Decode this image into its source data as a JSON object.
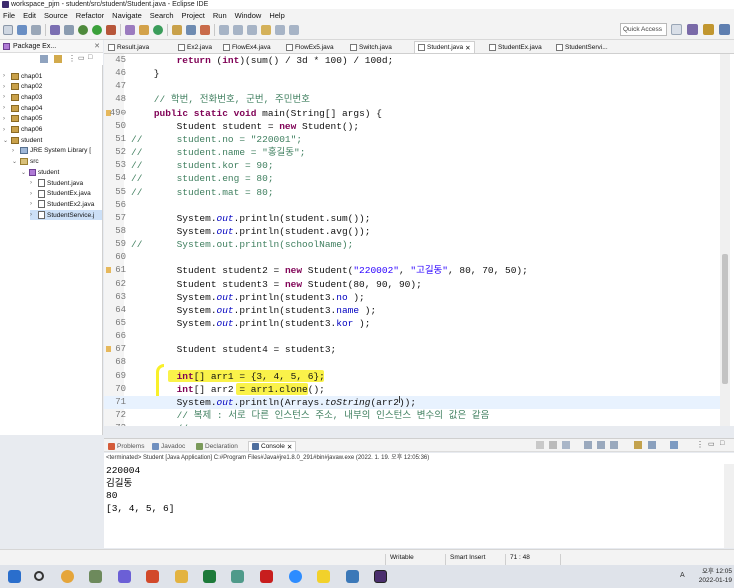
{
  "window": {
    "title": "workspace_pjm - student/src/student/Student.java - Eclipse IDE"
  },
  "menu": [
    "File",
    "Edit",
    "Source",
    "Refactor",
    "Navigate",
    "Search",
    "Project",
    "Run",
    "Window",
    "Help"
  ],
  "quick_access": {
    "placeholder": "Quick Access"
  },
  "package_explorer": {
    "title": "Package Ex...",
    "items": [
      {
        "label": "chap01",
        "level": 0,
        "type": "project",
        "expanded": false
      },
      {
        "label": "chap02",
        "level": 0,
        "type": "project",
        "expanded": false
      },
      {
        "label": "chap03",
        "level": 0,
        "type": "project",
        "expanded": false
      },
      {
        "label": "chap04",
        "level": 0,
        "type": "project",
        "expanded": false
      },
      {
        "label": "chap05",
        "level": 0,
        "type": "project",
        "expanded": false
      },
      {
        "label": "chap06",
        "level": 0,
        "type": "project",
        "expanded": false
      },
      {
        "label": "student",
        "level": 0,
        "type": "project",
        "expanded": true
      },
      {
        "label": "JRE System Library [",
        "level": 1,
        "type": "library",
        "expanded": false
      },
      {
        "label": "src",
        "level": 1,
        "type": "src",
        "expanded": true
      },
      {
        "label": "student",
        "level": 2,
        "type": "package",
        "expanded": true
      },
      {
        "label": "Student.java",
        "level": 3,
        "type": "java",
        "expanded": false
      },
      {
        "label": "StudentEx.java",
        "level": 3,
        "type": "java",
        "expanded": false
      },
      {
        "label": "StudentEx2.java",
        "level": 3,
        "type": "java",
        "expanded": false
      },
      {
        "label": "StudentService.j",
        "level": 3,
        "type": "java",
        "expanded": false,
        "selected": true
      }
    ]
  },
  "editor_tabs": [
    {
      "label": "Result.java",
      "active": false
    },
    {
      "label": "Ex2.java",
      "active": false
    },
    {
      "label": "FlowEx4.java",
      "active": false
    },
    {
      "label": "FlowEx5.java",
      "active": false
    },
    {
      "label": "Switch.java",
      "active": false
    },
    {
      "label": "Student.java",
      "active": true
    },
    {
      "label": "StudentEx.java",
      "active": false
    },
    {
      "label": "StudentServi...",
      "active": false
    }
  ],
  "editor_tabs_overflow": "52",
  "code_lines": [
    {
      "no": "45",
      "text": "        return (int)(sum() / 3d * 100) / 100d;"
    },
    {
      "no": "46",
      "text": "    }"
    },
    {
      "no": "47",
      "text": ""
    },
    {
      "no": "48",
      "text": "    // 학번, 전화번호, 군번, 주민번호"
    },
    {
      "no": "49⊖",
      "text": "    public static void main(String[] args) {"
    },
    {
      "no": "50",
      "text": "        Student student = new Student();"
    },
    {
      "no": "51",
      "text": "//      student.no = \"220001\";"
    },
    {
      "no": "52",
      "text": "//      student.name = \"홍길동\";"
    },
    {
      "no": "53",
      "text": "//      student.kor = 90;"
    },
    {
      "no": "54",
      "text": "//      student.eng = 80;"
    },
    {
      "no": "55",
      "text": "//      student.mat = 80;"
    },
    {
      "no": "56",
      "text": ""
    },
    {
      "no": "57",
      "text": "        System.out.println(student.sum());"
    },
    {
      "no": "58",
      "text": "        System.out.println(student.avg());"
    },
    {
      "no": "59",
      "text": "//      System.out.println(schoolName);"
    },
    {
      "no": "60",
      "text": ""
    },
    {
      "no": "61",
      "text": "        Student student2 = new Student(\"220002\", \"고길동\", 80, 70, 50);"
    },
    {
      "no": "62",
      "text": "        Student student3 = new Student(80, 90, 90);"
    },
    {
      "no": "63",
      "text": "        System.out.println(student3.no );"
    },
    {
      "no": "64",
      "text": "        System.out.println(student3.name );"
    },
    {
      "no": "65",
      "text": "        System.out.println(student3.kor );"
    },
    {
      "no": "66",
      "text": ""
    },
    {
      "no": "67",
      "text": "        Student student4 = student3;"
    },
    {
      "no": "68",
      "text": ""
    },
    {
      "no": "69",
      "text": "        int[] arr1 = {3, 4, 5, 6};"
    },
    {
      "no": "70",
      "text": "        int[] arr2 = arr1.clone();"
    },
    {
      "no": "71",
      "text": "        System.out.println(Arrays.toString(arr2));"
    },
    {
      "no": "72",
      "text": "        // 복제 : 서로 다른 인스턴스 주소, 내부의 인스턴스 변수의 값은 같음"
    },
    {
      "no": "73",
      "text": "        //"
    }
  ],
  "console_tabs": [
    {
      "label": "Problems",
      "active": false
    },
    {
      "label": "Javadoc",
      "active": false
    },
    {
      "label": "Declaration",
      "active": false
    },
    {
      "label": "Console",
      "active": true
    }
  ],
  "console": {
    "status": "<terminated> Student [Java Application] C:#Program Files#Java#jre1.8.0_291#bin#javaw.exe (2022. 1. 19. 오후 12:05:36)",
    "output": [
      "220004",
      "김길동",
      "80",
      "[3, 4, 5, 6]"
    ]
  },
  "statusbar": {
    "mode": "Writable",
    "insert": "Smart Insert",
    "position": "71 : 48"
  },
  "taskbar": {
    "time": "오후 12:05",
    "date": "2022-01-19"
  },
  "colors": {
    "keyword": "#7f0055",
    "string": "#2a00ff",
    "comment": "#3f7f5f",
    "field": "#0000c0",
    "highlight": "#f9f02a"
  }
}
